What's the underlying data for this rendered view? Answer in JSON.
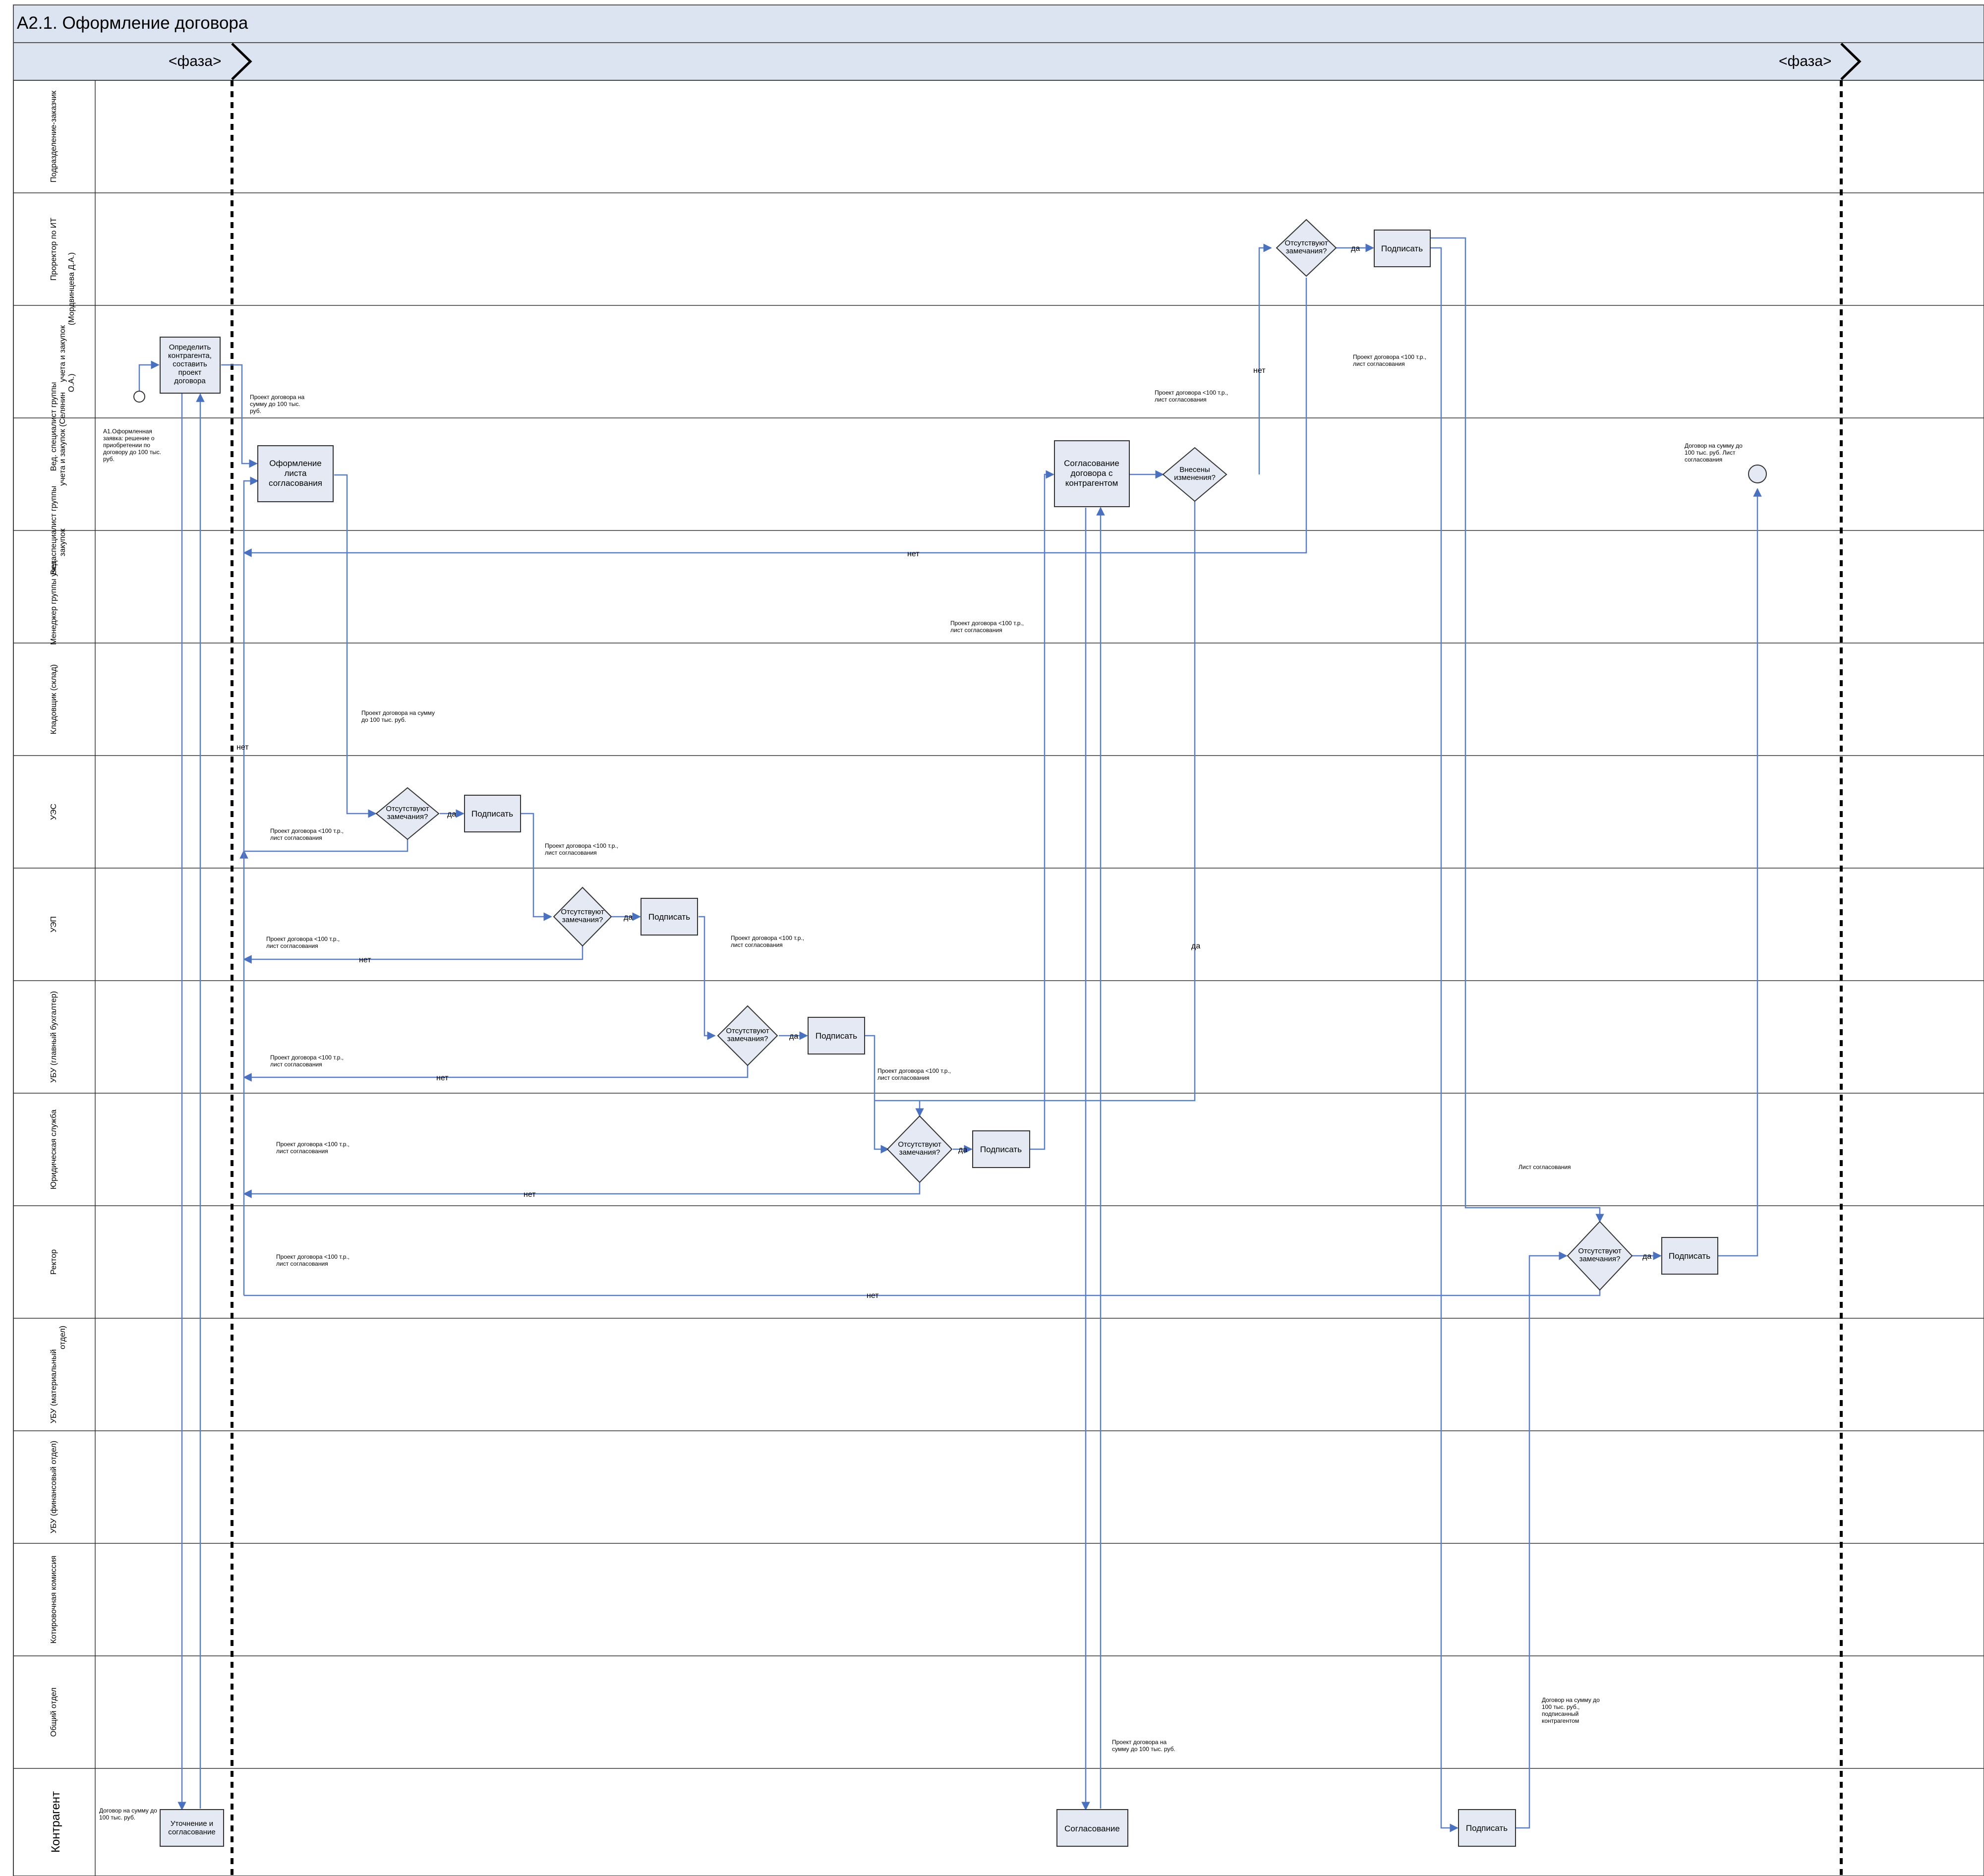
{
  "title": "А2.1. Оформление договора",
  "phases": [
    "<фаза>",
    "<фаза>"
  ],
  "lanes": [
    "Подразделение-заказчик",
    "Проректор по ИТ",
    "Вед. специалист группы учета и закупок (Мордвинцева Д.А.)",
    "Вед. специалист группы учета и закупок (Селянин О.А.)",
    "Менеджер группы учета закупок",
    "Кладовщик (склад)",
    "УЭС",
    "УЭП",
    "УБУ (главный бухгалтер)",
    "Юридическая служба",
    "Ректор",
    "УБУ (материальный отдел)",
    "УБУ (финансовый отдел)",
    "Котировочная комиссия",
    "Общий отдел",
    "Контрагент"
  ],
  "labels": {
    "task_define": "Определить контрагента, составить проект договора",
    "task_sheet": "Оформление листа согласования",
    "task_agree_counterparty": "Согласование договора с контрагентом",
    "task_clarify": "Уточнение и согласование",
    "task_agree": "Согласование",
    "sign": "Подписать",
    "question_remarks": "Отсутствуют замечания?",
    "question_changes": "Внесены изменения?",
    "yes": "да",
    "no": "нет",
    "note_request": "А1.Оформленная заявка: решение о приобретении по договору до 100 тыс. руб.",
    "note_project_100": "Проект договора на сумму до 100 тыс. руб.",
    "note_project_sheet": "Проект договора <100 т.р., лист согласования",
    "note_sheet": "Лист согласования",
    "note_signed_counterparty": "Договор на сумму до 100 тыс. руб., подписанный контрагентом",
    "note_end": "Договор на сумму до 100 тыс. руб. Лист согласования",
    "note_contract_counterparty": "Договор на сумму до 100 тыс. руб."
  }
}
